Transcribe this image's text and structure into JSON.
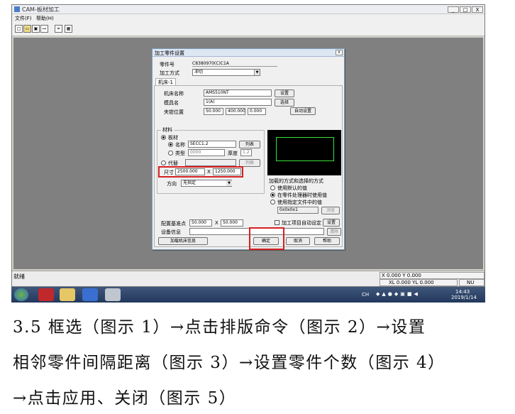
{
  "window": {
    "title": "CAM-板材加工",
    "menu": [
      "文件(F)",
      "帮助(H)"
    ],
    "toolbar_icons": [
      "new-icon",
      "open-icon",
      "save-icon",
      "import-icon",
      "xy-icon",
      "nesting-icon"
    ],
    "controls": [
      "_",
      "□",
      "X"
    ]
  },
  "status": {
    "left": "就绪",
    "coord1": "X 0.000 Y 0.000",
    "coord2": "XL 0.000 YL 0.000",
    "mode": "NU"
  },
  "taskbar": {
    "tray_text": "CH",
    "time": "14:43",
    "date": "2019/1/14"
  },
  "dialog": {
    "title": "加工零件设置",
    "part_no_label": "零件号",
    "part_no_value": "C8380970(C)C1A",
    "method_label": "加工方式",
    "method_value": "冲切",
    "tab": "机床-1",
    "machine_label": "机床名称",
    "machine_value": "AMS510NT",
    "machine_btn": "设置",
    "mold_label": "模具名",
    "mold_value": "1(A)",
    "mold_btn": "选择",
    "origin_label": "夹钳位置",
    "origin_x": "50.000",
    "origin_y": "400.000",
    "origin_z": "0.000",
    "auto_btn": "自动设置",
    "material": {
      "group": "材料",
      "r_sheet": "板材",
      "name_label": "名称",
      "name_value": "SECC1.2",
      "list_btn": "列表",
      "type_label": "类型",
      "type_value": "0000",
      "thick_label": "厚度",
      "thick_value": "1.2",
      "r_custom": "代替",
      "custom_btn": "列表",
      "size_label": "尺寸",
      "size_w": "2500.000",
      "size_x": "X",
      "size_h": "1250.000",
      "dir_label": "方向",
      "dir_value": "无指定"
    },
    "right_group": {
      "title": "加载的方式和选择的方式",
      "opt1": "使用默认的值",
      "opt2": "在零件处理器时使用值",
      "opt3": "使用指定文件中的值",
      "file_value": "0x0x0x1",
      "file_btn": "浏览"
    },
    "margin_label": "配置基准点",
    "margin_a": "50.000",
    "margin_sep": "X",
    "margin_b": "50.000",
    "auto_check": "加工项目自动设定",
    "auto_check_btn": "设置",
    "note_label": "设备信息",
    "note_btn": "清除",
    "add_btn": "加载机床信息",
    "ok_btn": "确定",
    "cancel_btn": "取消",
    "help_btn": "帮助"
  },
  "caption": {
    "line1": "3.5 框选（图示 1）→点击排版命令（图示 2）→设置",
    "line2": "相邻零件间隔距离（图示 3）→设置零件个数（图示 4）",
    "line3": "→点击应用、关闭（图示 5）"
  }
}
